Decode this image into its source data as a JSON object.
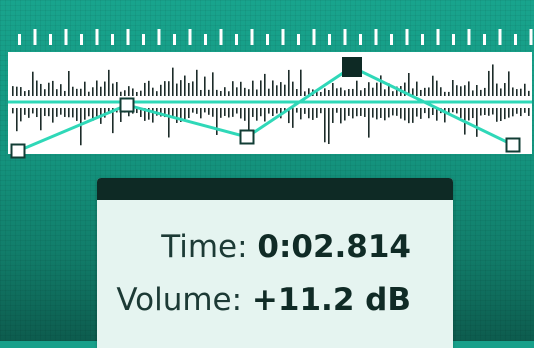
{
  "time": {
    "label": "Time:",
    "value": "0:02.814"
  },
  "volume": {
    "label": "Volume:",
    "value": "+11.2 dB"
  },
  "envelope": {
    "points": [
      {
        "name": "envelope-point-1",
        "selected": false
      },
      {
        "name": "envelope-point-2",
        "selected": false
      },
      {
        "name": "envelope-point-3",
        "selected": false
      },
      {
        "name": "envelope-point-4",
        "selected": true
      },
      {
        "name": "envelope-point-5",
        "selected": false
      }
    ]
  },
  "colors": {
    "background": "#17a08a",
    "envelope_line": "#2fd8b8",
    "panel": "#e5f4f0",
    "panel_titlebar": "#0e2a25",
    "text": "#1c3a35"
  }
}
